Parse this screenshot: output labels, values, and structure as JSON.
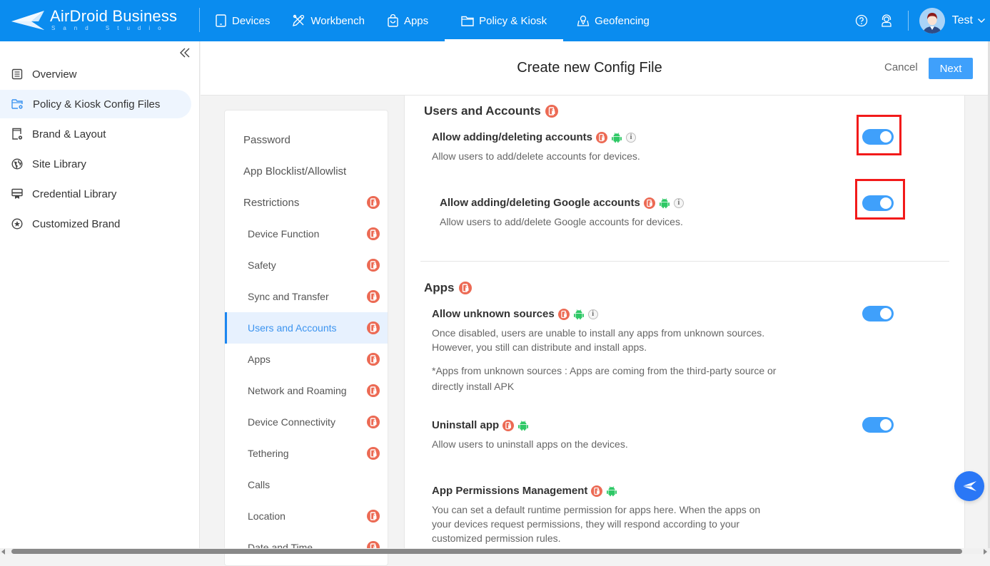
{
  "brand": {
    "name": "AirDroid Business",
    "tagline": "Sand Studio"
  },
  "topnav": {
    "items": [
      {
        "id": "devices",
        "label": "Devices",
        "icon": "tablet-icon"
      },
      {
        "id": "workbench",
        "label": "Workbench",
        "icon": "tools-icon"
      },
      {
        "id": "apps",
        "label": "Apps",
        "icon": "bag-icon"
      },
      {
        "id": "policy-kiosk",
        "label": "Policy & Kiosk",
        "icon": "folder-icon",
        "active": true
      },
      {
        "id": "geofencing",
        "label": "Geofencing",
        "icon": "map-pin-icon"
      }
    ],
    "help_icon": "help-circle-icon",
    "support_icon": "support-agent-icon",
    "user": {
      "name": "Test"
    }
  },
  "sidebar": {
    "collapse_icon": "double-chevron-left-icon",
    "items": [
      {
        "label": "Overview",
        "icon": "document-icon"
      },
      {
        "label": "Policy & Kiosk Config Files",
        "icon": "folder-gear-icon",
        "active": true
      },
      {
        "label": "Brand & Layout",
        "icon": "device-gear-icon"
      },
      {
        "label": "Site Library",
        "icon": "globe-icon"
      },
      {
        "label": "Credential Library",
        "icon": "certificate-icon"
      },
      {
        "label": "Customized Brand",
        "icon": "star-circle-icon"
      }
    ]
  },
  "header": {
    "title": "Create new Config File",
    "cancel_label": "Cancel",
    "next_label": "Next"
  },
  "subnav": {
    "items": [
      {
        "label": "Password",
        "level": 1,
        "locked": false
      },
      {
        "label": "App Blocklist/Allowlist",
        "level": 1,
        "locked": false
      },
      {
        "label": "Restrictions",
        "level": 1,
        "locked": true
      },
      {
        "label": "Device Function",
        "level": 2,
        "locked": true
      },
      {
        "label": "Safety",
        "level": 2,
        "locked": true
      },
      {
        "label": "Sync and Transfer",
        "level": 2,
        "locked": true
      },
      {
        "label": "Users and Accounts",
        "level": 2,
        "locked": true,
        "active": true
      },
      {
        "label": "Apps",
        "level": 2,
        "locked": true
      },
      {
        "label": "Network and Roaming",
        "level": 2,
        "locked": true
      },
      {
        "label": "Device Connectivity",
        "level": 2,
        "locked": true
      },
      {
        "label": "Tethering",
        "level": 2,
        "locked": true
      },
      {
        "label": "Calls",
        "level": 2,
        "locked": false
      },
      {
        "label": "Location",
        "level": 2,
        "locked": true
      },
      {
        "label": "Date and Time",
        "level": 2,
        "locked": true
      }
    ]
  },
  "sections": {
    "users_accounts": {
      "title": "Users and Accounts",
      "settings": [
        {
          "title": "Allow adding/deleting accounts",
          "desc": "Allow users to add/delete accounts for devices.",
          "enabled": true,
          "highlighted": true,
          "android": true,
          "info": true
        },
        {
          "title": "Allow adding/deleting Google accounts",
          "desc": "Allow users to add/delete Google accounts for devices.",
          "enabled": true,
          "highlighted": true,
          "android": true,
          "info": true
        }
      ]
    },
    "apps": {
      "title": "Apps",
      "settings": [
        {
          "title": "Allow unknown sources",
          "desc": "Once disabled, users are unable to install any apps from unknown sources. However, you still can distribute and install apps.",
          "note": "*Apps from unknown sources : Apps are coming from the third-party source or directly install APK",
          "enabled": true,
          "android": true,
          "info": true
        },
        {
          "title": "Uninstall app",
          "desc": "Allow users to uninstall apps on the devices.",
          "enabled": true,
          "android": true,
          "info": false
        },
        {
          "title": "App Permissions Management",
          "desc": "You can set a default runtime permission for apps here. When the apps on your devices request permissions, they will respond according to your customized permission rules.",
          "android": true,
          "info": false
        }
      ]
    }
  },
  "colors": {
    "brand_blue": "#0a8cef",
    "primary_button": "#3fa0fb",
    "lock_badge": "#ec6a54",
    "android_green": "#2ec866",
    "highlight_red": "#f21a1a",
    "active_nav_bg": "#e7f1fe"
  },
  "info_glyph": "i",
  "float_button_icon": "airdroid-plane-icon"
}
